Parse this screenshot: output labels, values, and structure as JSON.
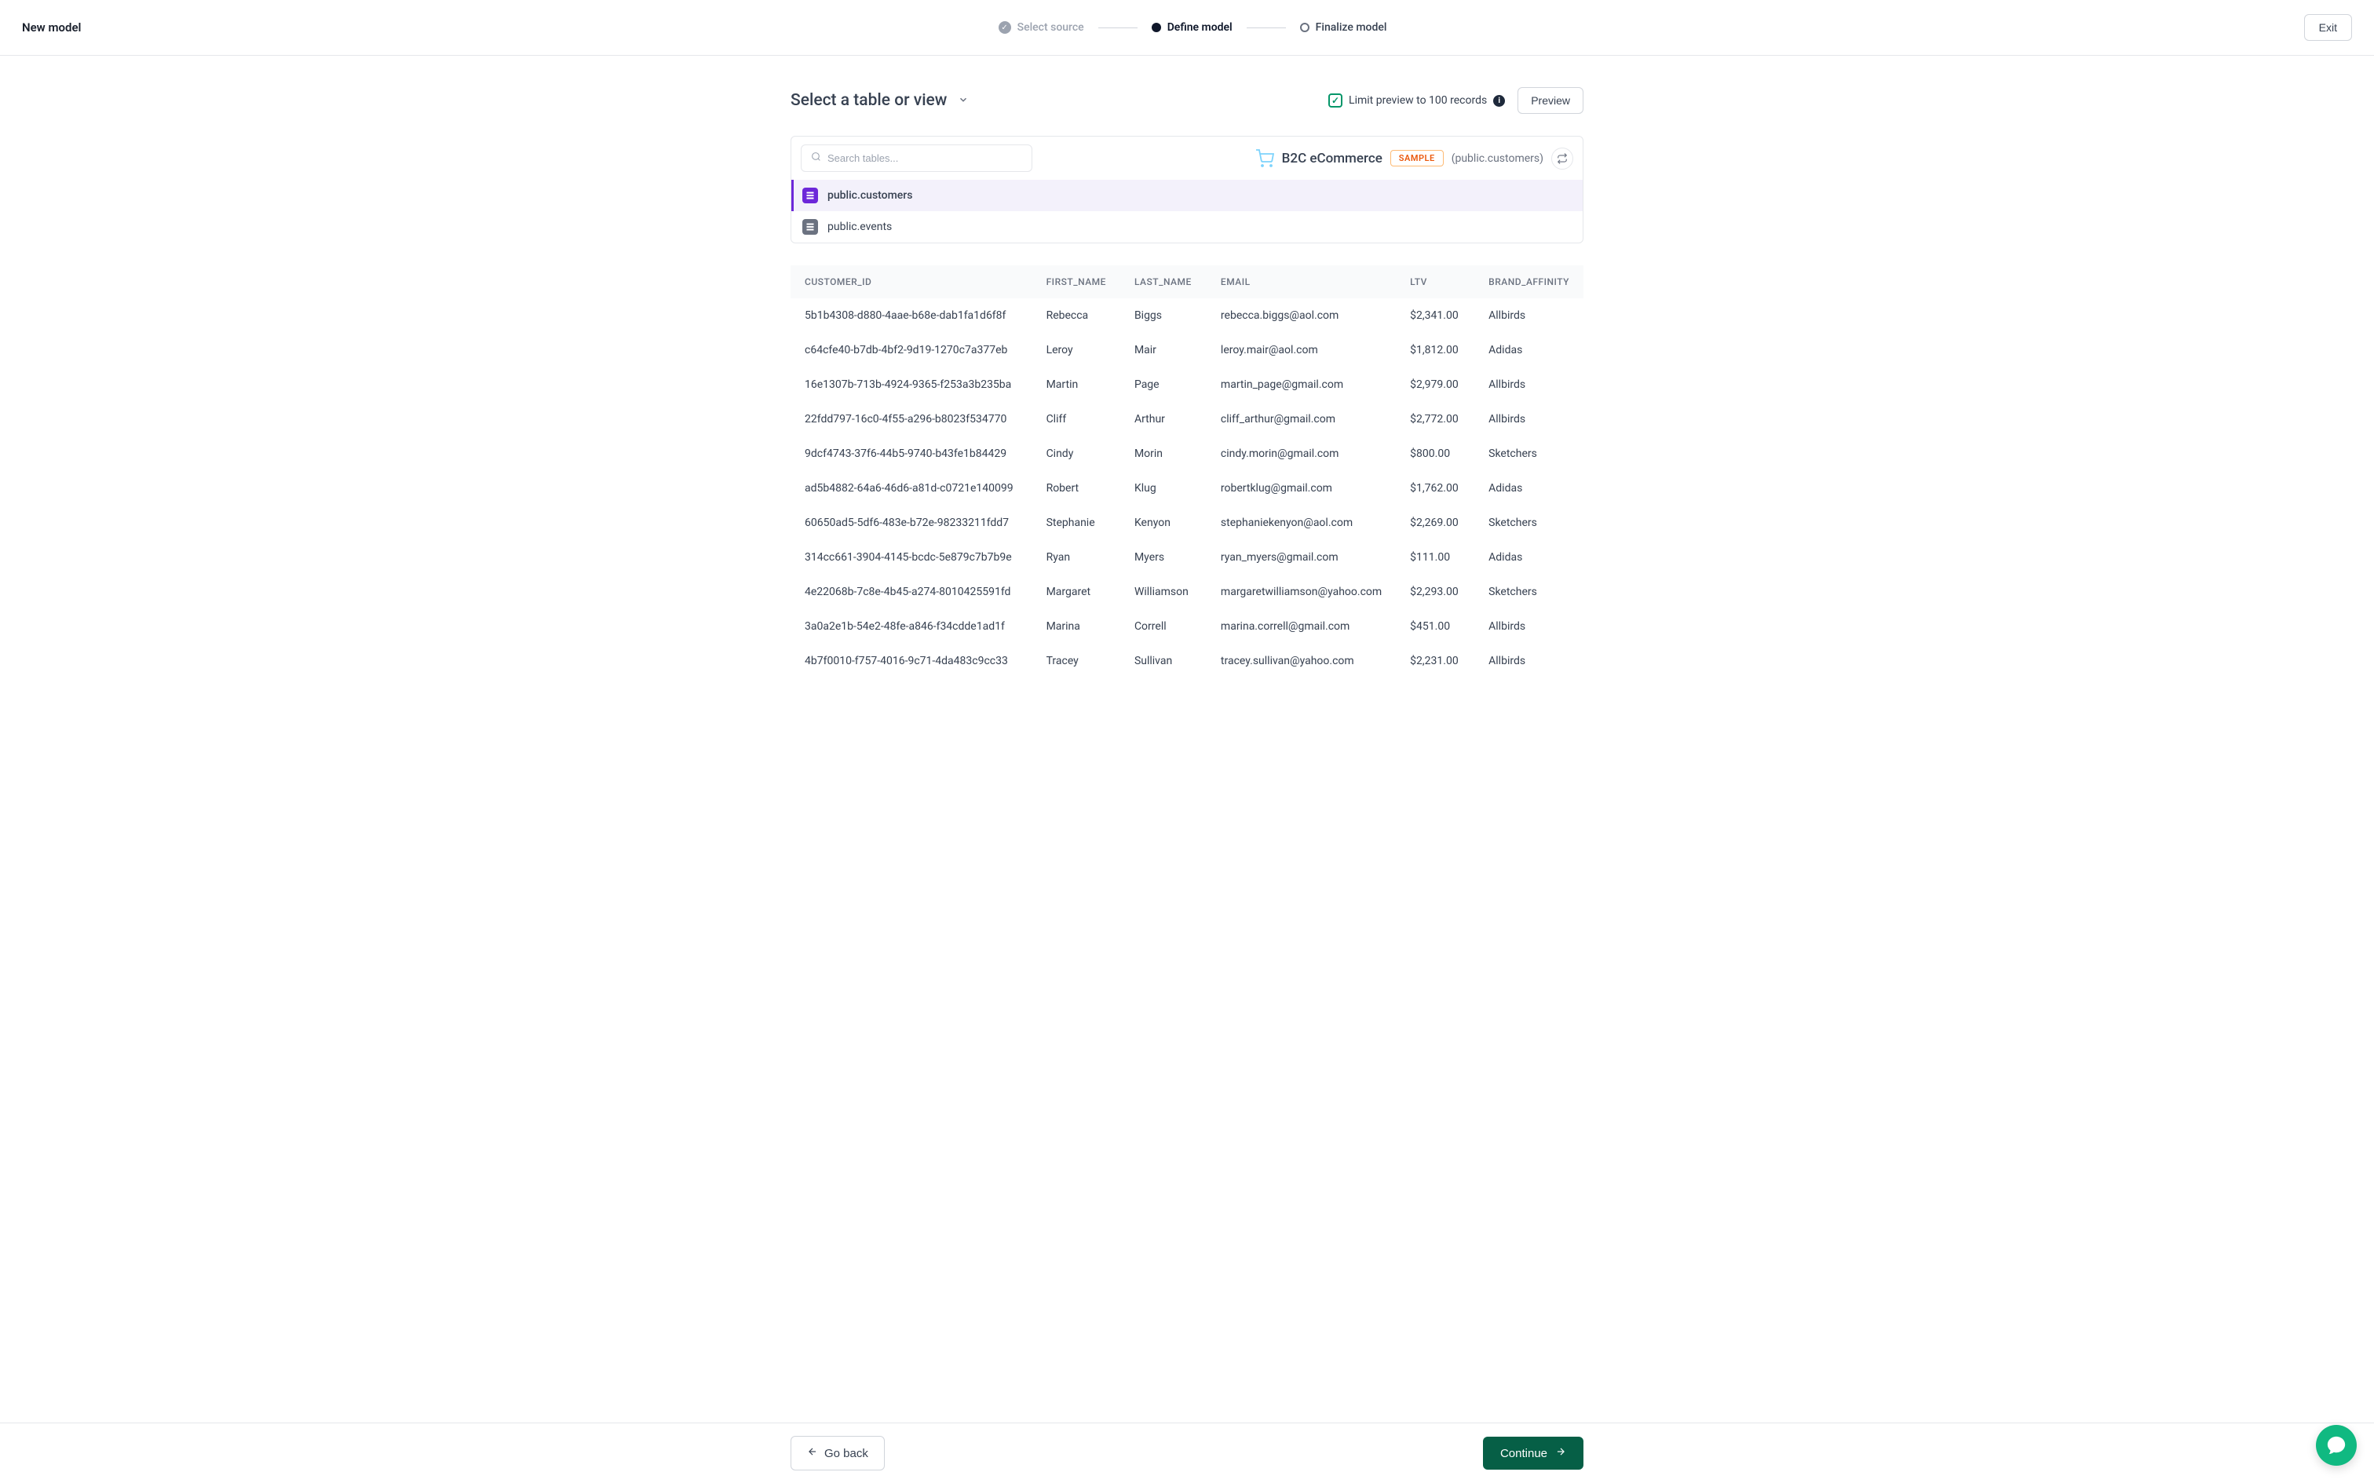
{
  "header": {
    "title": "New model",
    "steps": [
      {
        "label": "Select source",
        "state": "done"
      },
      {
        "label": "Define model",
        "state": "active"
      },
      {
        "label": "Finalize model",
        "state": "upcoming"
      }
    ],
    "exit": "Exit"
  },
  "selector": {
    "title": "Select a table or view",
    "limit_label": "Limit preview to 100 records",
    "limit_checked": true,
    "preview_btn": "Preview"
  },
  "tables_panel": {
    "search_placeholder": "Search tables...",
    "source_name": "B2C eCommerce",
    "sample_badge": "SAMPLE",
    "source_sub": "(public.customers)",
    "tables": [
      {
        "name": "public.customers",
        "active": true
      },
      {
        "name": "public.events",
        "active": false
      }
    ]
  },
  "preview_table": {
    "columns": [
      "CUSTOMER_ID",
      "FIRST_NAME",
      "LAST_NAME",
      "EMAIL",
      "LTV",
      "BRAND_AFFINITY"
    ],
    "rows": [
      [
        "5b1b4308-d880-4aae-b68e-dab1fa1d6f8f",
        "Rebecca",
        "Biggs",
        "rebecca.biggs@aol.com",
        "$2,341.00",
        "Allbirds"
      ],
      [
        "c64cfe40-b7db-4bf2-9d19-1270c7a377eb",
        "Leroy",
        "Mair",
        "leroy.mair@aol.com",
        "$1,812.00",
        "Adidas"
      ],
      [
        "16e1307b-713b-4924-9365-f253a3b235ba",
        "Martin",
        "Page",
        "martin_page@gmail.com",
        "$2,979.00",
        "Allbirds"
      ],
      [
        "22fdd797-16c0-4f55-a296-b8023f534770",
        "Cliff",
        "Arthur",
        "cliff_arthur@gmail.com",
        "$2,772.00",
        "Allbirds"
      ],
      [
        "9dcf4743-37f6-44b5-9740-b43fe1b84429",
        "Cindy",
        "Morin",
        "cindy.morin@gmail.com",
        "$800.00",
        "Sketchers"
      ],
      [
        "ad5b4882-64a6-46d6-a81d-c0721e140099",
        "Robert",
        "Klug",
        "robertklug@gmail.com",
        "$1,762.00",
        "Adidas"
      ],
      [
        "60650ad5-5df6-483e-b72e-98233211fdd7",
        "Stephanie",
        "Kenyon",
        "stephaniekenyon@aol.com",
        "$2,269.00",
        "Sketchers"
      ],
      [
        "314cc661-3904-4145-bcdc-5e879c7b7b9e",
        "Ryan",
        "Myers",
        "ryan_myers@gmail.com",
        "$111.00",
        "Adidas"
      ],
      [
        "4e22068b-7c8e-4b45-a274-8010425591fd",
        "Margaret",
        "Williamson",
        "margaretwilliamson@yahoo.com",
        "$2,293.00",
        "Sketchers"
      ],
      [
        "3a0a2e1b-54e2-48fe-a846-f34cdde1ad1f",
        "Marina",
        "Correll",
        "marina.correll@gmail.com",
        "$451.00",
        "Allbirds"
      ],
      [
        "4b7f0010-f757-4016-9c71-4da483c9cc33",
        "Tracey",
        "Sullivan",
        "tracey.sullivan@yahoo.com",
        "$2,231.00",
        "Allbirds"
      ]
    ]
  },
  "footer": {
    "goback": "Go back",
    "continue": "Continue"
  }
}
